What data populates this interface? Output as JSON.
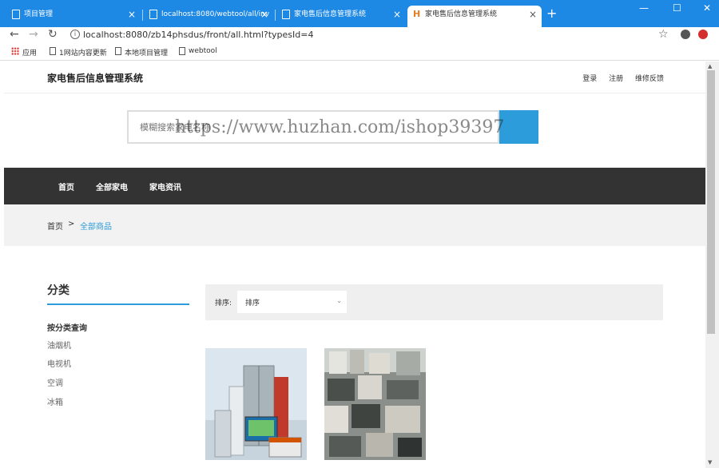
{
  "browser": {
    "tabs": [
      {
        "title": "项目管理"
      },
      {
        "title": "localhost:8080/webtool/all/inv"
      },
      {
        "title": "家电售后信息管理系统"
      },
      {
        "title": "家电售后信息管理系统"
      }
    ],
    "url": "localhost:8080/zb14phsdus/front/all.html?typesId=4",
    "bookmarks": [
      {
        "label": "应用"
      },
      {
        "label": "1网站内容更新"
      },
      {
        "label": "本地项目管理"
      },
      {
        "label": "webtool"
      }
    ]
  },
  "header": {
    "title": "家电售后信息管理系统",
    "links": {
      "login": "登录",
      "register": "注册",
      "feedback": "维修反馈"
    }
  },
  "search": {
    "placeholder": "模糊搜索家电名称"
  },
  "watermark": "https://www.huzhan.com/ishop39397",
  "nav": {
    "home": "首页",
    "all": "全部家电",
    "news": "家电资讯"
  },
  "breadcrumb": {
    "home": "首页",
    "separator": ">",
    "current": "全部商品"
  },
  "sidebar": {
    "title": "分类",
    "heading": "按分类查询",
    "items": [
      "油烟机",
      "电视机",
      "空调",
      "冰箱"
    ]
  },
  "sort": {
    "label": "排序:",
    "selected": "排序"
  },
  "colors": {
    "accent": "#2d9cdb",
    "nav_bg": "#333333",
    "tabbar": "#1e88e5"
  }
}
